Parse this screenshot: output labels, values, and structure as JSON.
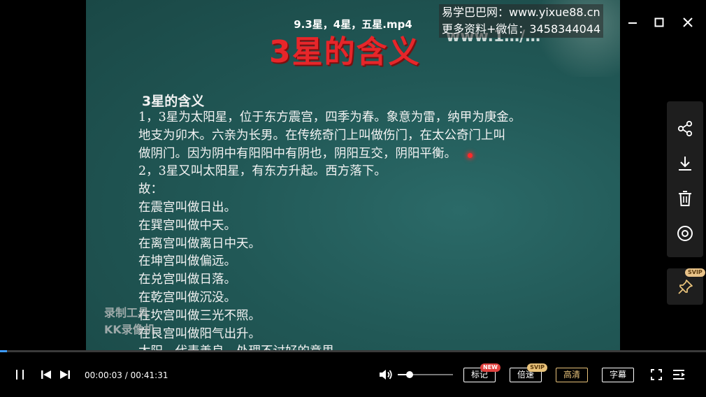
{
  "window": {
    "title": "9.3星，4星，五星.mp4",
    "watermark_lines": [
      "易学巴巴网：www.yixue88.cn",
      "更多资料+微信：3458344044"
    ]
  },
  "slide": {
    "title": "3星的含义",
    "url_fragment": "www.1…/…",
    "heading": "3星的含义",
    "lines": [
      "1，3星为太阳星，位于东方震宫，四季为春。象意为雷，纳甲为庚金。",
      "地支为卯木。六亲为长男。在传统奇门上叫做伤门，在太公奇门上叫",
      "做阴门。因为阴中有阳阳中有阴也，阴阳互交，阴阳平衡。",
      "2，3星又叫太阳星，有东方升起。西方落下。",
      "故：",
      "在震宫叫做日出。",
      "在巽宫叫做中天。",
      "在离宫叫做离日中天。",
      "在坤宫叫做偏远。",
      "在兑宫叫做日落。",
      "在乾宫叫做沉没。",
      "在坎宫叫做三光不照。",
      "在艮宫叫做阳气出升。",
      "太阳，代表善良，处理不讨好的意思。"
    ],
    "recorder_watermark": [
      "录制工具",
      "KK录像机"
    ]
  },
  "side_panel": {
    "icons": [
      "share-icon",
      "download-icon",
      "delete-icon",
      "eye-icon"
    ],
    "pin_icon": "pin-icon",
    "pin_badge": "SVIP"
  },
  "playback": {
    "current_time": "00:00:03",
    "separator": " / ",
    "total_time": "00:41:31",
    "progress_fraction": 0.0012,
    "volume_fraction": 0.22
  },
  "buttons": {
    "mark": "标记",
    "mark_badge": "NEW",
    "speed": "倍速",
    "speed_badge": "SVIP",
    "quality": "高清",
    "subtitle": "字幕"
  },
  "colors": {
    "accent": "#3d9bff",
    "gold": "#e8c27a",
    "slide_bg": "#215856",
    "slide_title": "#e7262a"
  }
}
